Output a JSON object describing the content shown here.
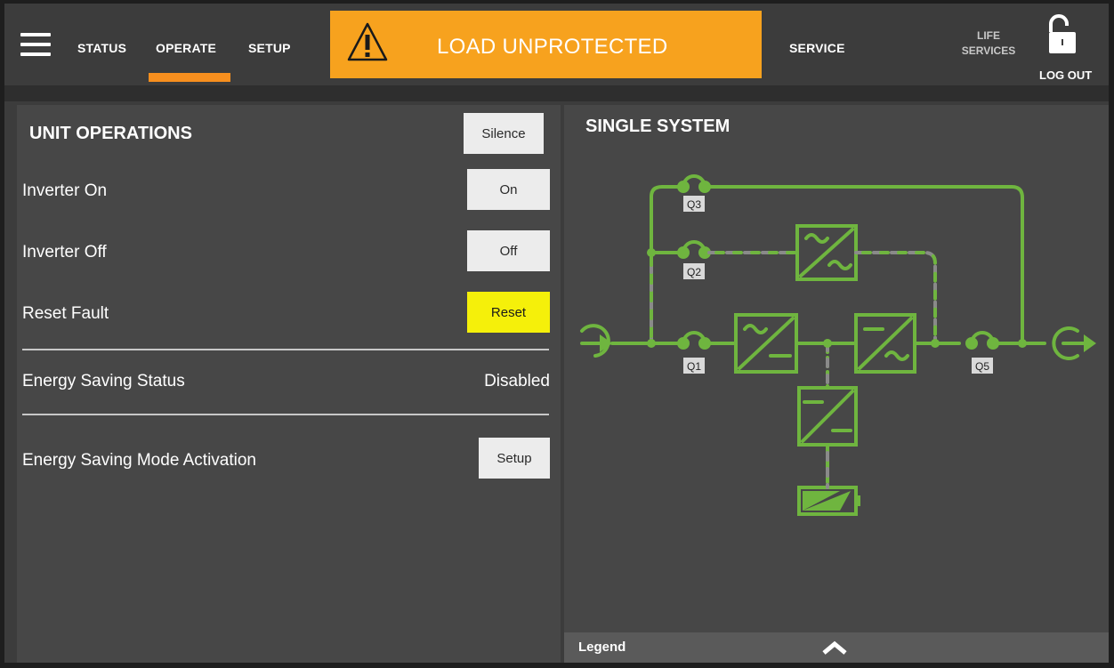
{
  "header": {
    "nav": {
      "status": "STATUS",
      "operate": "OPERATE",
      "setup": "SETUP",
      "service": "SERVICE",
      "life_services_line1": "LIFE",
      "life_services_line2": "SERVICES",
      "logout": "LOG OUT"
    },
    "active_tab": "OPERATE",
    "alarm_text": "LOAD UNPROTECTED",
    "colors": {
      "alarm": "#f7a21e",
      "active_underline": "#f78f1e"
    }
  },
  "unit_operations": {
    "title": "UNIT OPERATIONS",
    "silence_button": "Silence",
    "rows": [
      {
        "label": "Inverter On",
        "button": "On"
      },
      {
        "label": "Inverter Off",
        "button": "Off"
      },
      {
        "label": "Reset Fault",
        "button": "Reset"
      }
    ],
    "energy_saving_status": {
      "label": "Energy Saving Status",
      "value": "Disabled"
    },
    "energy_saving_mode": {
      "label": "Energy Saving Mode Activation",
      "button": "Setup"
    },
    "colors": {
      "reset_button": "#f5f00a"
    }
  },
  "single_system": {
    "title": "SINGLE SYSTEM",
    "switches": {
      "q1": "Q1",
      "q2": "Q2",
      "q3": "Q3",
      "q5": "Q5"
    },
    "legend_label": "Legend",
    "icons": [
      "input-arrow-icon",
      "output-arrow-icon",
      "rectifier-icon",
      "inverter-icon",
      "static-bypass-icon",
      "dc-converter-icon",
      "battery-icon",
      "chevron-up-icon"
    ],
    "colors": {
      "line": "#6fb53f",
      "dashed": "#8a8a8a"
    }
  }
}
